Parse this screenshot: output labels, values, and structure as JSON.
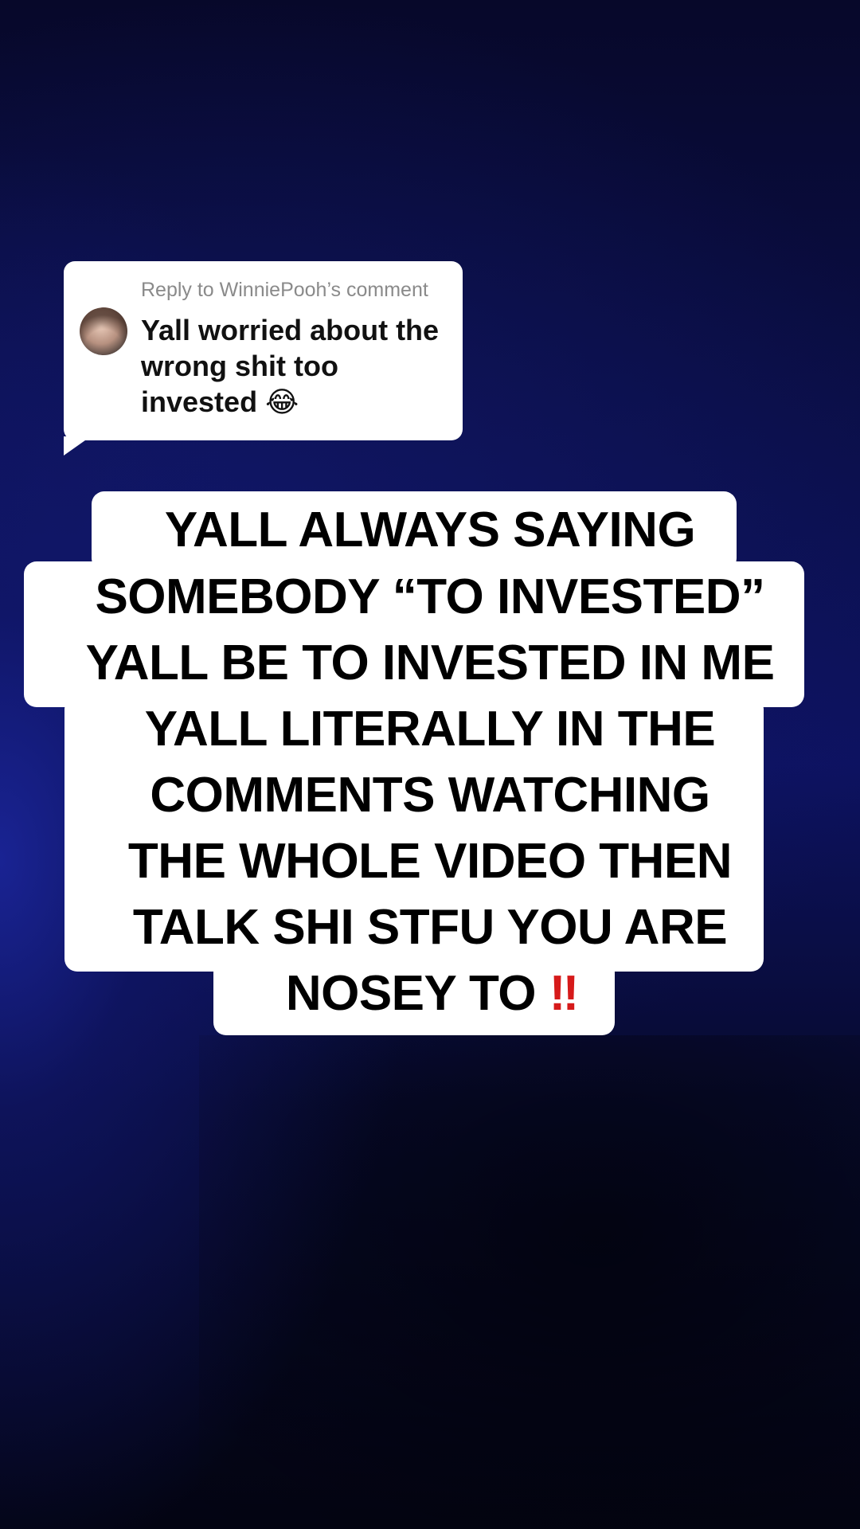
{
  "reply": {
    "header": "Reply to WinniePooh’s comment",
    "comment_text": "Yall worried about the wrong shit too invested",
    "comment_emoji": "😂"
  },
  "caption": {
    "lines": [
      "YALL ALWAYS SAYING",
      "SOMEBODY “TO INVESTED”",
      "YALL BE TO INVESTED IN ME",
      "YALL LITERALLY IN THE",
      "COMMENTS WATCHING",
      "THE WHOLE VIDEO THEN",
      "TALK SHI STFU YOU ARE",
      "NOSEY TO"
    ],
    "end_emoji": "‼"
  },
  "colors": {
    "background_top": "#07082a",
    "background_mid": "#0d1260",
    "background_glow": "#1a2496",
    "bubble": "#ffffff",
    "caption_text": "#000000",
    "emoji_red": "#d61a1a",
    "reply_header": "#8a8a8a"
  }
}
